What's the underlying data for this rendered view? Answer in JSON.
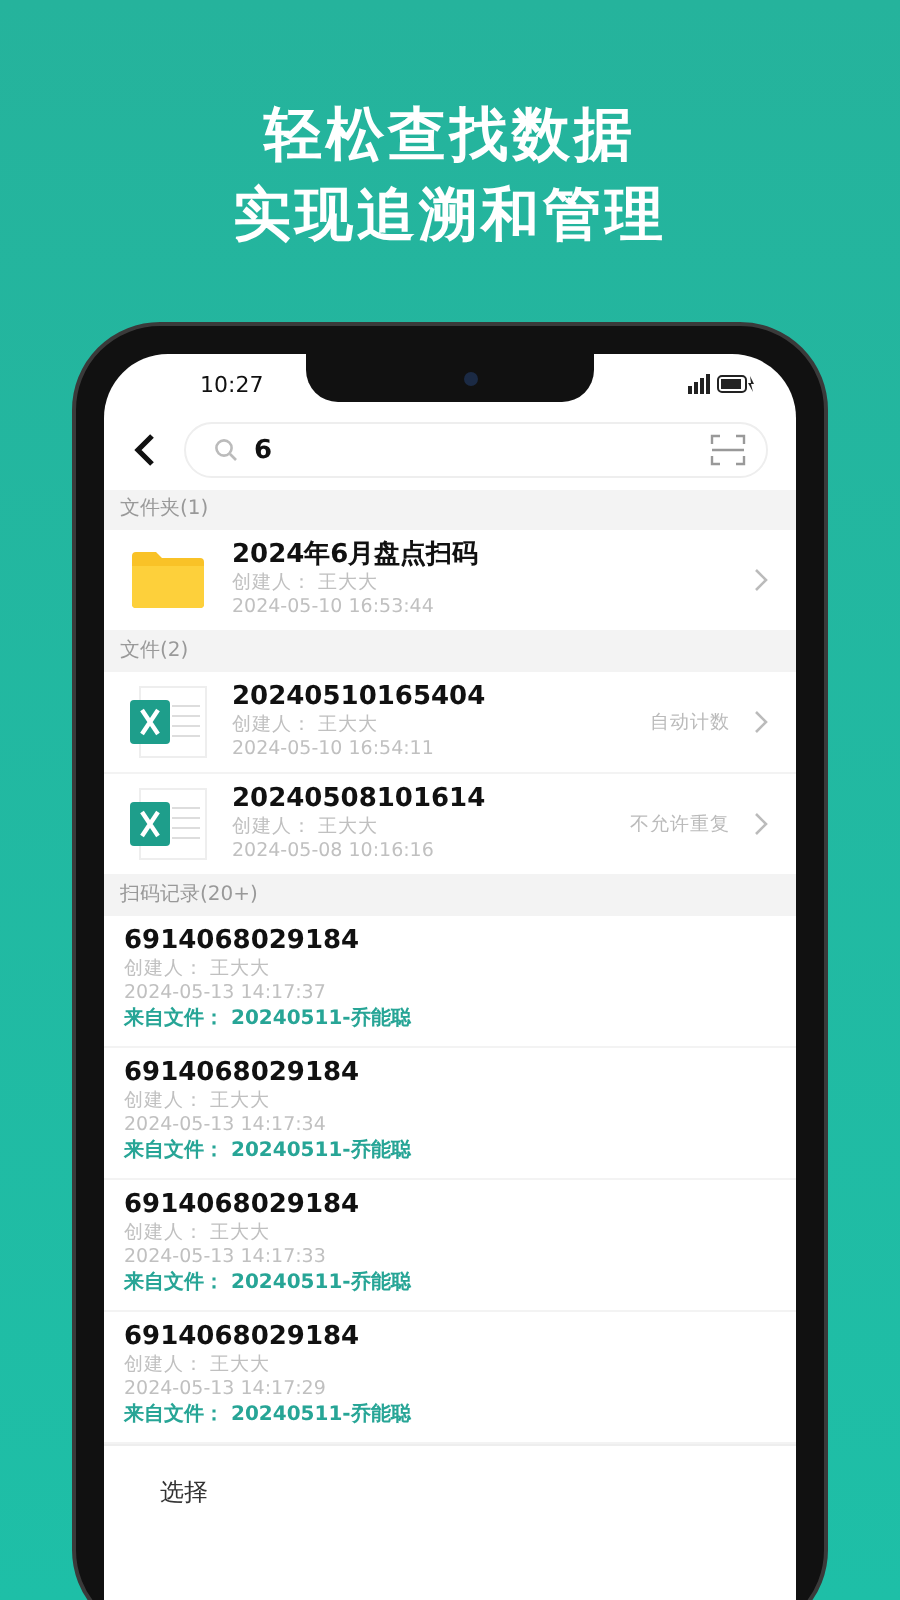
{
  "headline": [
    "轻松查找数据",
    "实现追溯和管理"
  ],
  "status_bar": {
    "time": "10:27"
  },
  "search": {
    "value": "6"
  },
  "sections": [
    {
      "title": "文件夹(1)",
      "items": [
        {
          "kind": "folder",
          "name": "2024年6月盘点扫码",
          "creator": "创建人： 王大大",
          "time": "2024-05-10 16:53:44"
        }
      ]
    },
    {
      "title": "文件(2)",
      "items": [
        {
          "kind": "file",
          "name": "20240510165404",
          "creator": "创建人： 王大大",
          "time": "2024-05-10 16:54:11",
          "tag": "自动计数"
        },
        {
          "kind": "file",
          "name": "20240508101614",
          "creator": "创建人： 王大大",
          "time": "2024-05-08 10:16:16",
          "tag": "不允许重复"
        }
      ]
    },
    {
      "title": "扫码记录(20+)",
      "items": [
        {
          "kind": "record",
          "name": "6914068029184",
          "creator": "创建人： 王大大",
          "time": "2024-05-13 14:17:37",
          "source": "来自文件： 20240511-乔能聪"
        },
        {
          "kind": "record",
          "name": "6914068029184",
          "creator": "创建人： 王大大",
          "time": "2024-05-13 14:17:34",
          "source": "来自文件： 20240511-乔能聪"
        },
        {
          "kind": "record",
          "name": "6914068029184",
          "creator": "创建人： 王大大",
          "time": "2024-05-13 14:17:33",
          "source": "来自文件： 20240511-乔能聪"
        },
        {
          "kind": "record",
          "name": "6914068029184",
          "creator": "创建人： 王大大",
          "time": "2024-05-13 14:17:29",
          "source": "来自文件： 20240511-乔能聪"
        }
      ]
    }
  ],
  "bottom_bar": {
    "action": "选择"
  }
}
